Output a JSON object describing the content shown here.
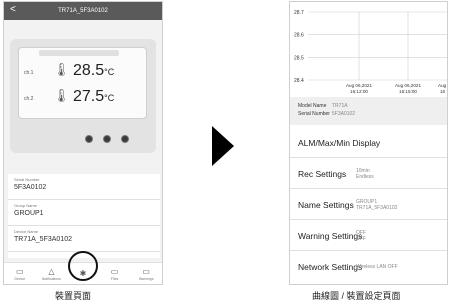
{
  "left_screen": {
    "header_title": "TR71A_5F3A0102",
    "back_glyph": "<",
    "lcd": {
      "channel1_label": "ch.1",
      "channel2_label": "ch.2",
      "reading1": "28.5",
      "reading2": "27.5",
      "unit": "°C"
    },
    "info": [
      {
        "label": "Serial Number",
        "value": "5F3A0102"
      },
      {
        "label": "Group Name",
        "value": "GROUP1"
      },
      {
        "label": "Device Name",
        "value": "TR71A_5F3A0102"
      }
    ],
    "nav": [
      {
        "label": "Device",
        "icon": "▭"
      },
      {
        "label": "Notifications",
        "icon": "△"
      },
      {
        "label": "",
        "icon": "✱"
      },
      {
        "label": "Files",
        "icon": "▭"
      },
      {
        "label": "Warnings",
        "icon": "▭"
      }
    ]
  },
  "caption_left": "裝置頁面",
  "right_screen": {
    "chart_data": {
      "type": "line",
      "ylim": [
        28.4,
        28.7
      ],
      "y_ticks": [
        "28.7",
        "28.6",
        "28.5",
        "28.4"
      ],
      "x_ticks": [
        {
          "date": "Aug 06,2021",
          "time": "16:12:00"
        },
        {
          "date": "Aug 06,2021",
          "time": "16:15:00"
        },
        {
          "date": "Aug",
          "time": "16"
        }
      ]
    },
    "model_name_label": "Model Name",
    "model_name_value": "TR71A",
    "serial_label": "Serial Number",
    "serial_value": "5F3A0102",
    "settings": [
      {
        "label": "ALM/Max/Min Display",
        "sub1": "",
        "sub2": ""
      },
      {
        "label": "Rec Settings",
        "sub1": "10min",
        "sub2": "Endless"
      },
      {
        "label": "Name Settings",
        "sub1": "GROUP1",
        "sub2": "TR71A_5F3A0102"
      },
      {
        "label": "Warning Settings",
        "sub1": "OFF",
        "sub2": "OFF"
      },
      {
        "label": "Network Settings",
        "sub1": "Wireless LAN OFF",
        "sub2": ""
      }
    ]
  },
  "caption_right": "曲線圖 / 裝置設定頁面"
}
